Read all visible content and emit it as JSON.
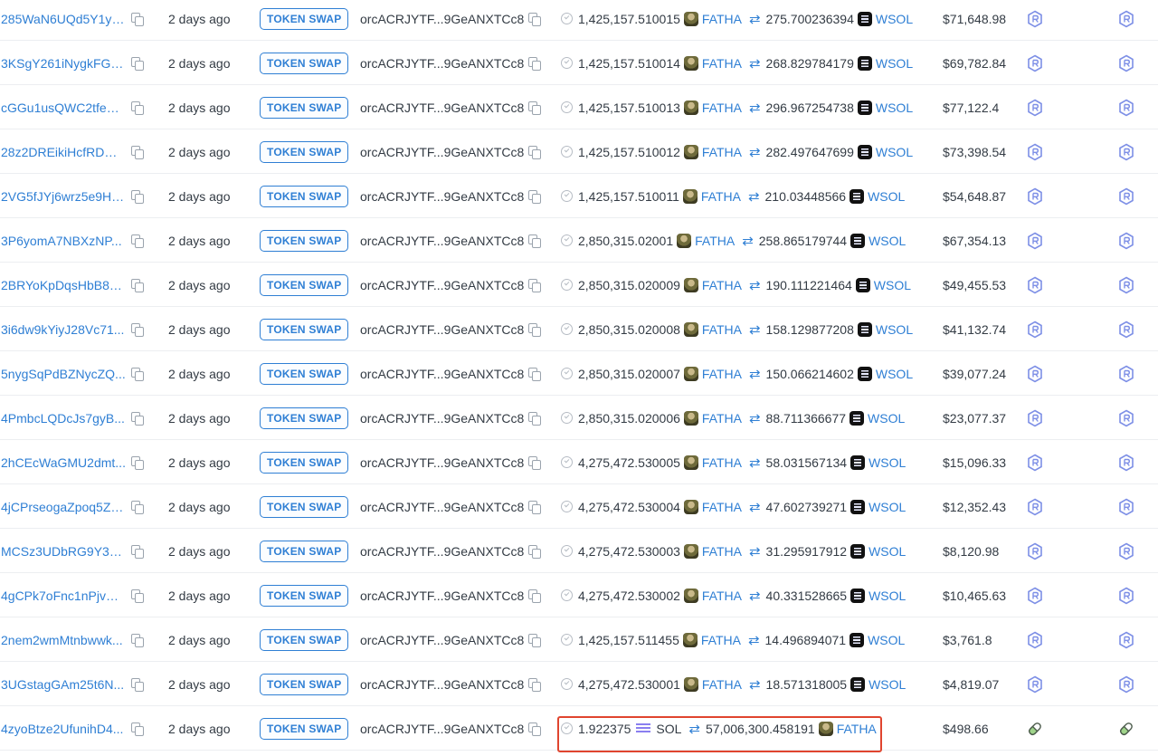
{
  "columns": {
    "tx_type_label": "TOKEN SWAP",
    "signer": "orcACRJYTF...9GeANXTCc8"
  },
  "colors": {
    "link": "#2f7fd4",
    "highlight_border": "#e0452f"
  },
  "icons": {
    "copy": "copy-icon",
    "status": "check-circle-icon",
    "swap": "swap-arrows-icon",
    "program": "raydium-hexagon-icon",
    "program_alt": "pill-capsule-icon"
  },
  "rows": [
    {
      "sig": "285WaN6UQd5Y1yq...",
      "time": "2 days ago",
      "amount_in": "1,425,157.510015",
      "token_in": "FATHA",
      "amount_out": "275.700236394",
      "token_out": "WSOL",
      "value": "$71,648.98"
    },
    {
      "sig": "3KSgY261iNygkFGK...",
      "time": "2 days ago",
      "amount_in": "1,425,157.510014",
      "token_in": "FATHA",
      "amount_out": "268.829784179",
      "token_out": "WSOL",
      "value": "$69,782.84"
    },
    {
      "sig": "cGGu1usQWC2tfeT2...",
      "time": "2 days ago",
      "amount_in": "1,425,157.510013",
      "token_in": "FATHA",
      "amount_out": "296.967254738",
      "token_out": "WSOL",
      "value": "$77,122.4"
    },
    {
      "sig": "28z2DREikiHcfRDDU...",
      "time": "2 days ago",
      "amount_in": "1,425,157.510012",
      "token_in": "FATHA",
      "amount_out": "282.497647699",
      "token_out": "WSOL",
      "value": "$73,398.54"
    },
    {
      "sig": "2VG5fJYj6wrz5e9HT...",
      "time": "2 days ago",
      "amount_in": "1,425,157.510011",
      "token_in": "FATHA",
      "amount_out": "210.03448566",
      "token_out": "WSOL",
      "value": "$54,648.87"
    },
    {
      "sig": "3P6yomA7NBXzNP...",
      "time": "2 days ago",
      "amount_in": "2,850,315.02001",
      "token_in": "FATHA",
      "amount_out": "258.865179744",
      "token_out": "WSOL",
      "value": "$67,354.13"
    },
    {
      "sig": "2BRYoKpDqsHbB8P...",
      "time": "2 days ago",
      "amount_in": "2,850,315.020009",
      "token_in": "FATHA",
      "amount_out": "190.111221464",
      "token_out": "WSOL",
      "value": "$49,455.53"
    },
    {
      "sig": "3i6dw9kYiyJ28Vc71...",
      "time": "2 days ago",
      "amount_in": "2,850,315.020008",
      "token_in": "FATHA",
      "amount_out": "158.129877208",
      "token_out": "WSOL",
      "value": "$41,132.74"
    },
    {
      "sig": "5nygSqPdBZNycZQ...",
      "time": "2 days ago",
      "amount_in": "2,850,315.020007",
      "token_in": "FATHA",
      "amount_out": "150.066214602",
      "token_out": "WSOL",
      "value": "$39,077.24"
    },
    {
      "sig": "4PmbcLQDcJs7gyB...",
      "time": "2 days ago",
      "amount_in": "2,850,315.020006",
      "token_in": "FATHA",
      "amount_out": "88.711366677",
      "token_out": "WSOL",
      "value": "$23,077.37"
    },
    {
      "sig": "2hCEcWaGMU2dmt...",
      "time": "2 days ago",
      "amount_in": "4,275,472.530005",
      "token_in": "FATHA",
      "amount_out": "58.031567134",
      "token_out": "WSOL",
      "value": "$15,096.33"
    },
    {
      "sig": "4jCPrseogaZpoq5ZS...",
      "time": "2 days ago",
      "amount_in": "4,275,472.530004",
      "token_in": "FATHA",
      "amount_out": "47.602739271",
      "token_out": "WSOL",
      "value": "$12,352.43"
    },
    {
      "sig": "MCSz3UDbRG9Y3H...",
      "time": "2 days ago",
      "amount_in": "4,275,472.530003",
      "token_in": "FATHA",
      "amount_out": "31.295917912",
      "token_out": "WSOL",
      "value": "$8,120.98"
    },
    {
      "sig": "4gCPk7oFnc1nPjvCj...",
      "time": "2 days ago",
      "amount_in": "4,275,472.530002",
      "token_in": "FATHA",
      "amount_out": "40.331528665",
      "token_out": "WSOL",
      "value": "$10,465.63"
    },
    {
      "sig": "2nem2wmMtnbwwk...",
      "time": "2 days ago",
      "amount_in": "1,425,157.511455",
      "token_in": "FATHA",
      "amount_out": "14.496894071",
      "token_out": "WSOL",
      "value": "$3,761.8"
    },
    {
      "sig": "3UGstagGAm25t6N...",
      "time": "2 days ago",
      "amount_in": "4,275,472.530001",
      "token_in": "FATHA",
      "amount_out": "18.571318005",
      "token_out": "WSOL",
      "value": "$4,819.07"
    },
    {
      "sig": "4zyoBtze2UfunihD4...",
      "time": "2 days ago",
      "amount_in": "1.922375",
      "token_in": "SOL",
      "amount_out": "57,006,300.458191",
      "token_out": "FATHA",
      "value": "$498.66",
      "highlighted": true
    }
  ]
}
